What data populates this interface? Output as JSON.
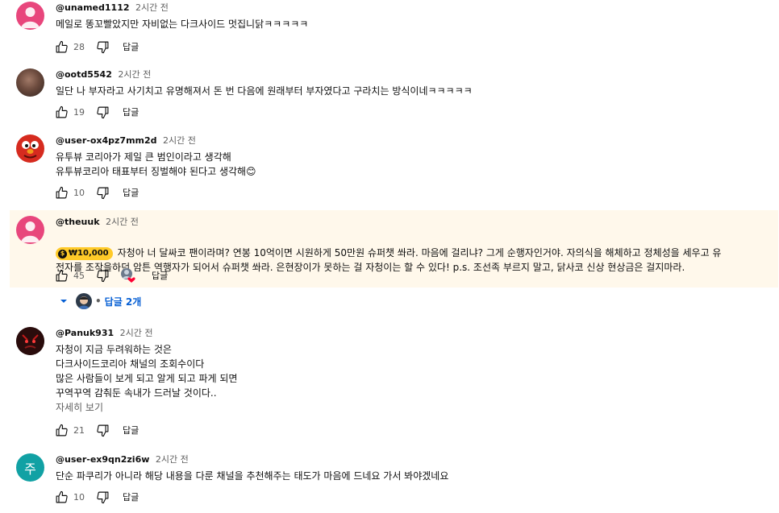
{
  "reply_label": "답글",
  "comments": [
    {
      "author": "@unamed1112",
      "time": "2시간 전",
      "text": "메일로 똥꼬빨았지만 자비없는 다크사이드 멋집니닭ㅋㅋㅋㅋㅋ",
      "likes": "28",
      "avatar_color": "#e8467c"
    },
    {
      "author": "@ootd5542",
      "time": "2시간 전",
      "text": "일단 나 부자라고 사기치고 유명해져서 돈 번 다음에 원래부터 부자였다고 구라치는 방식이네ㅋㅋㅋㅋㅋ",
      "likes": "19",
      "avatar_color": "#5a3e33"
    },
    {
      "author": "@user-ox4pz7mm2d",
      "time": "2시간 전",
      "text": "유투뷰 코리아가 제일 큰 범인이라고 생각해\n유투뷰코리아 태표부터 징벌해야 된다고 생각해😊",
      "likes": "10",
      "avatar_color": "#d62b1f"
    },
    {
      "author": "@theuuk",
      "time": "2시간 전",
      "badge": "₩10,000",
      "text": "자청아 너 달싸코 팬이라며? 연봉 10억이면 시원하게 50만원 슈퍼챗 쏴라. 마음에 걸리냐? 그게 순행자인거야. 자의식을 해체하고 정체성을 세우고 유\n전자를 조작을하던 암튼 역행자가 되어서 슈퍼챗 쏴라. 은현장이가 못하는 걸 자청이는 할 수 있다! p.s. 조선족 부르지 말고, 닭사코 신상 현상금은 걸지마라.",
      "likes": "45",
      "avatar_color": "#e8467c",
      "replies_label": "답글 2개"
    },
    {
      "author": "@Panuk931",
      "time": "2시간 전",
      "text": "자청이 지금 두려워하는 것은\n다크사이드코리아 채널의 조회수이다\n많은 사람들이 보게 되고 알게 되고 파게 되면\n꾸역꾸역 감춰둔 속내가 드러날 것이다..",
      "read_more": "자세히 보기",
      "likes": "21",
      "avatar_color": "#3a1414"
    },
    {
      "author": "@user-ex9qn2zi6w",
      "time": "2시간 전",
      "text": "단순 파쿠리가 아니라 해당 내용을 다룬 채널을 추천해주는 태도가 마음에 드네요 가서 봐야겠네요",
      "likes": "10",
      "avatar_color": "#11a1a4",
      "avatar_letter": "주"
    }
  ]
}
